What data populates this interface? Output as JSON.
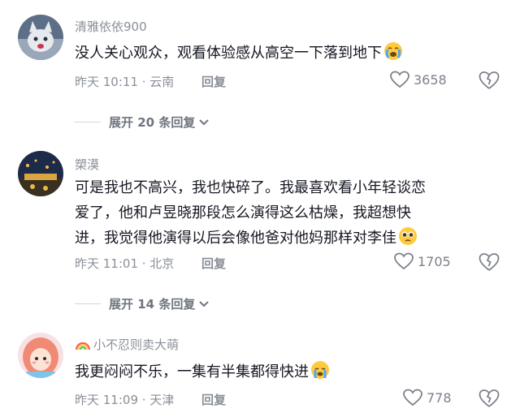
{
  "comments": [
    {
      "username": "清雅依依900",
      "text_lines": [
        "没人关心观众，观看体验感从高空一下落到地下"
      ],
      "emoji": "crying-face-emoji",
      "time_location": "昨天 10:11 · 云南",
      "reply_label": "回复",
      "like_count": "3658",
      "expand_label": "展开 20 条回复"
    },
    {
      "username": "槊漠",
      "text_lines": [
        "可是我也不高兴，我也快碎了。我最喜欢看小年轻谈恋",
        "爱了，他和卢昱晓那段怎么演得这么枯燥，我超想快",
        "进，我觉得他演得以后会像他爸对他妈那样对李佳"
      ],
      "emoji": "pleading-face-emoji",
      "time_location": "昨天 11:01 · 北京",
      "reply_label": "回复",
      "like_count": "1705",
      "expand_label": "展开 14 条回复"
    },
    {
      "username": "小不忍则卖大萌",
      "username_prefix_icon": "rainbow-icon",
      "text_lines": [
        "我更闷闷不乐，一集有半集都得快进"
      ],
      "emoji": "sad-cry-face-emoji",
      "time_location": "昨天 11:09 · 天津",
      "reply_label": "回复",
      "like_count": "778"
    }
  ],
  "colors": {
    "text": "#161823",
    "meta": "#8a8f99",
    "emoji_yellow": "#ffcb3d",
    "emoji_blue": "#4aa6ff"
  }
}
